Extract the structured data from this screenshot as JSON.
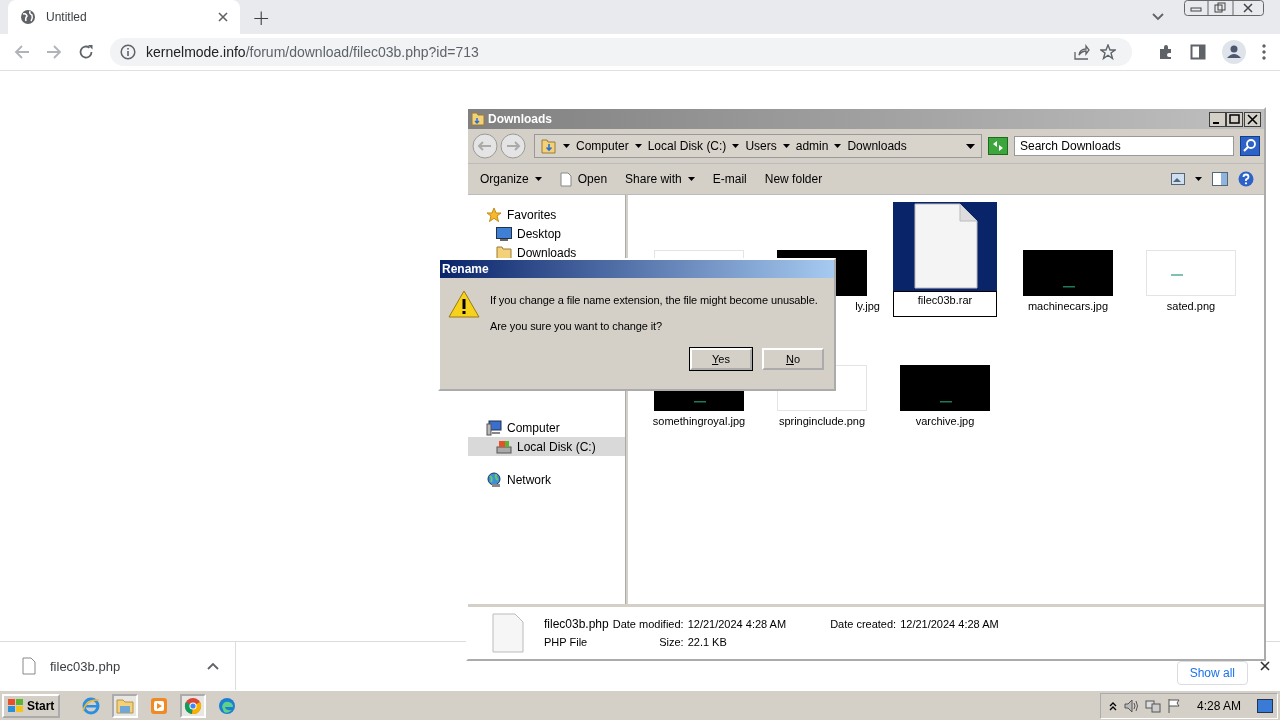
{
  "browser": {
    "tabs": [
      {
        "title": "Untitled",
        "selected": true
      }
    ],
    "new_tab": "+",
    "url_host": "kernelmode.info",
    "url_path": "/forum/download/filec03b.php?id=713"
  },
  "download_bar": {
    "items": [
      {
        "name": "filec03b.php"
      }
    ],
    "show_all": "Show all"
  },
  "explorer": {
    "title": "Downloads",
    "breadcrumb": [
      "Computer",
      "Local Disk (C:)",
      "Users",
      "admin",
      "Downloads"
    ],
    "search": {
      "placeholder": "Search Downloads"
    },
    "toolbar": [
      {
        "label": "Organize",
        "kind": "menu"
      },
      {
        "label": "Open",
        "kind": "open"
      },
      {
        "label": "Share with",
        "kind": "menu"
      },
      {
        "label": "E-mail",
        "kind": "plain"
      },
      {
        "label": "New folder",
        "kind": "plain"
      }
    ],
    "nav": [
      {
        "label": "Favorites",
        "kind": "star",
        "selected": false,
        "children": [
          {
            "label": "Desktop",
            "kind": "desktop",
            "selected": false
          },
          {
            "label": "Downloads",
            "kind": "folder",
            "selected": false
          }
        ]
      },
      {
        "label": "Computer",
        "kind": "computer",
        "selected": false,
        "children": [
          {
            "label": "Local Disk (C:)",
            "kind": "drive",
            "selected": true
          }
        ]
      },
      {
        "label": "Network",
        "kind": "network",
        "selected": false
      }
    ],
    "files": [
      {
        "kind": "light",
        "selected": false
      },
      {
        "name": "ly.jpg",
        "kind": "dark",
        "selected": false,
        "partial": true
      },
      {
        "name": "filec03b.rar",
        "kind": "file",
        "selected": true,
        "partial": false
      },
      {
        "name": "machinecars.jpg",
        "kind": "dark",
        "selected": false,
        "partial": false
      },
      {
        "name": "sated.png",
        "kind": "light",
        "selected": false,
        "partial": false
      },
      {
        "name": "somethingroyal.jpg",
        "kind": "dark",
        "selected": false,
        "partial": false
      },
      {
        "name": "springinclude.png",
        "kind": "light",
        "selected": false,
        "partial": false
      },
      {
        "name": "varchive.jpg",
        "kind": "dark",
        "selected": false,
        "partial": false
      }
    ],
    "details": {
      "name": "filec03b.php",
      "type": "PHP File",
      "fields": [
        {
          "label": "Date modified:",
          "value": "12/21/2024 4:28 AM"
        },
        {
          "label": "Size:",
          "value": "22.1 KB"
        },
        {
          "label": "Date created:",
          "value": "12/21/2024 4:28 AM"
        }
      ]
    }
  },
  "dialog": {
    "title": "Rename",
    "message": "If you change a file name extension, the file might become unusable.",
    "question": "Are you sure you want to change it?",
    "buttons": [
      {
        "label": "Yes",
        "default": true
      },
      {
        "label": "No",
        "default": false
      }
    ]
  },
  "taskbar": {
    "start": "Start",
    "apps": [
      {
        "kind": "ie",
        "active": false
      },
      {
        "kind": "explorer",
        "active": true
      },
      {
        "kind": "media",
        "active": false
      },
      {
        "kind": "chrome",
        "active": true
      },
      {
        "kind": "edge",
        "active": false
      }
    ],
    "clock": "4:28 AM"
  }
}
